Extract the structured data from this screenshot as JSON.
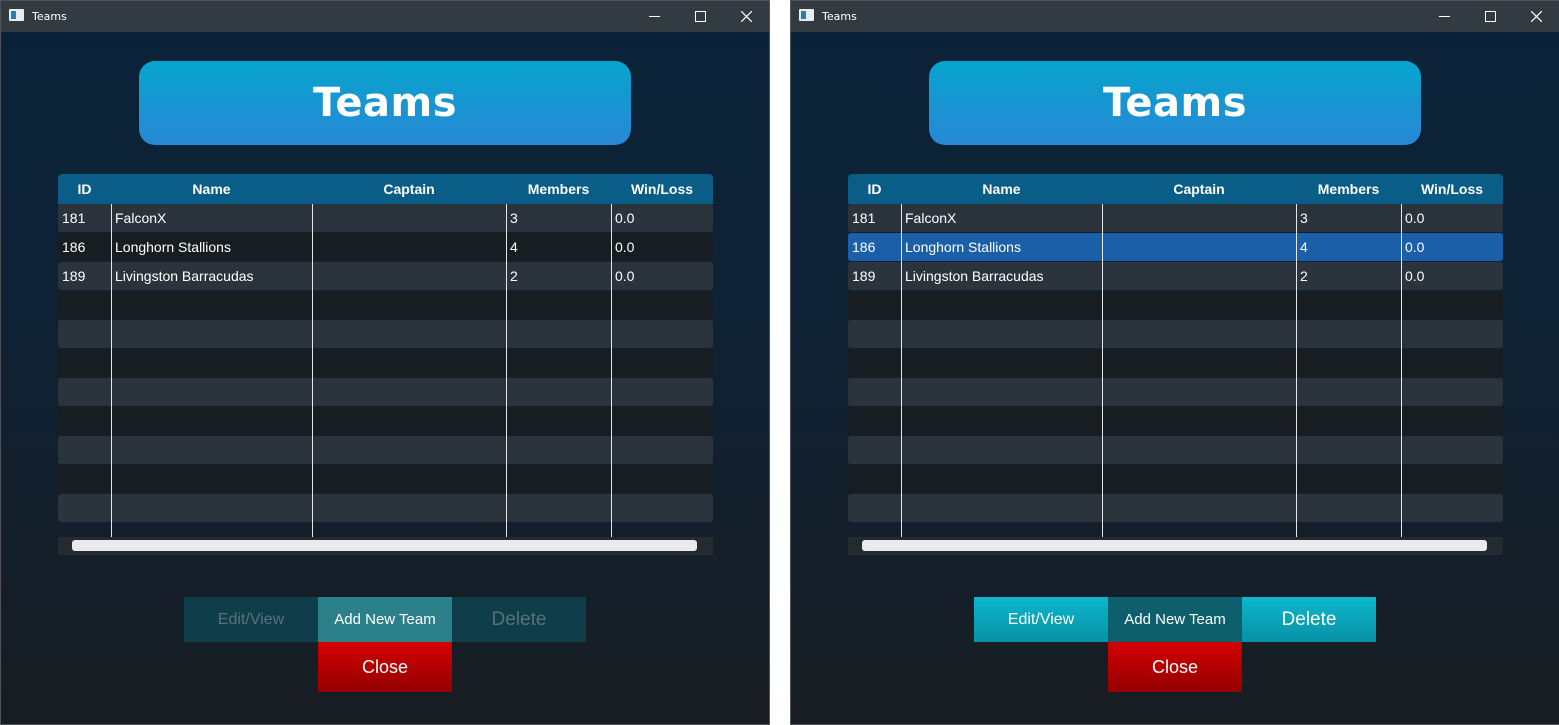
{
  "colors": {
    "selected_row": "#1b5fa9",
    "header": "#0a5d86",
    "close_button": "#c00000",
    "action_button": "#0aa6bb"
  },
  "windows": [
    {
      "title": "Teams",
      "icons": {
        "minimize": "minimize-icon",
        "maximize": "maximize-icon",
        "close": "close-icon"
      },
      "header": "Teams",
      "columns": [
        "ID",
        "Name",
        "Captain",
        "Members",
        "Win/Loss"
      ],
      "rows": [
        {
          "id": "181",
          "name": "FalconX",
          "captain": "",
          "members": "3",
          "winloss": "0.0"
        },
        {
          "id": "186",
          "name": "Longhorn Stallions",
          "captain": "",
          "members": "4",
          "winloss": "0.0"
        },
        {
          "id": "189",
          "name": "Livingston Barracudas",
          "captain": "",
          "members": "2",
          "winloss": "0.0"
        }
      ],
      "selected_row": "",
      "buttons": {
        "edit": "Edit/View",
        "add": "Add New Team",
        "delete": "Delete",
        "close": "Close"
      },
      "buttons_state": "disabled"
    },
    {
      "title": "Teams",
      "icons": {
        "minimize": "minimize-icon",
        "maximize": "maximize-icon",
        "close": "close-icon"
      },
      "header": "Teams",
      "columns": [
        "ID",
        "Name",
        "Captain",
        "Members",
        "Win/Loss"
      ],
      "rows": [
        {
          "id": "181",
          "name": "FalconX",
          "captain": "",
          "members": "3",
          "winloss": "0.0"
        },
        {
          "id": "186",
          "name": "Longhorn Stallions",
          "captain": "",
          "members": "4",
          "winloss": "0.0"
        },
        {
          "id": "189",
          "name": "Livingston Barracudas",
          "captain": "",
          "members": "2",
          "winloss": "0.0"
        }
      ],
      "selected_row": "186",
      "buttons": {
        "edit": "Edit/View",
        "add": "Add New Team",
        "delete": "Delete",
        "close": "Close"
      },
      "buttons_state": "enabled"
    }
  ]
}
